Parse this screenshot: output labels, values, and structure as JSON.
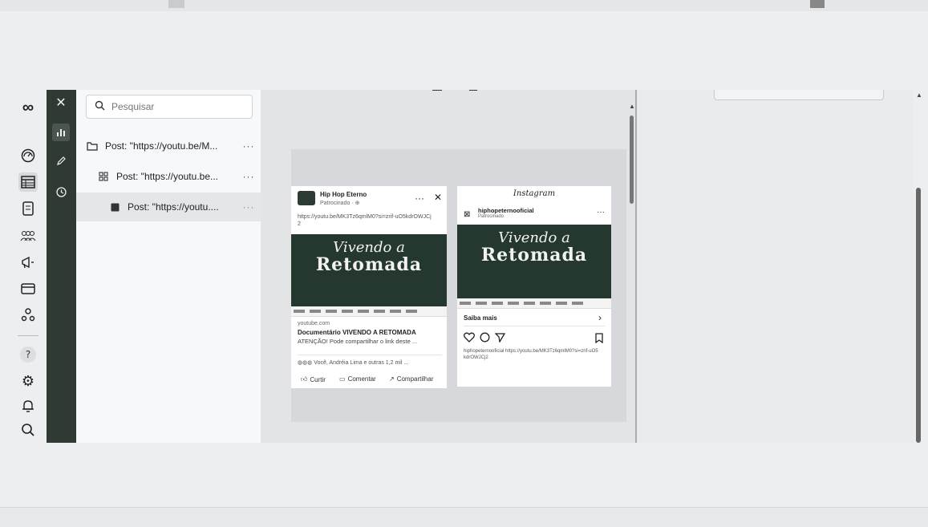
{
  "search": {
    "placeholder": "Pesquisar"
  },
  "tree": {
    "items": [
      {
        "label": "Post: \"https://youtu.be/M...",
        "more": "···"
      },
      {
        "label": "Post: \"https://youtu.be...",
        "more": "···"
      },
      {
        "label": "Post: \"https://youtu....",
        "more": "···"
      }
    ]
  },
  "facebook_post": {
    "page_name": "Hip Hop Eterno",
    "sponsored": "Patrocinado · ⊕",
    "link_text": "https://youtu.be/MK3Tz6qmlM0?si=zrif-uO5kdrOWJCj2",
    "banner_line1": "Vivendo a",
    "banner_line2": "Retomada",
    "domain": "youtube.com",
    "headline": "Documentário VIVENDO A RETOMADA",
    "description": "ATENÇÃO! Pode compartilhar o link deste ...",
    "reactions": "Você, Andréia Lima e outras 1,2 mil ...",
    "like": "Curtir",
    "comment": "Comentar",
    "share": "Compartilhar",
    "more": "···",
    "close": "✕"
  },
  "instagram_post": {
    "brand": "Instagram",
    "account": "hiphopeternooficial",
    "sponsored": "Patrocinado",
    "banner_line1": "Vivendo a",
    "banner_line2": "Retomada",
    "cta": "Saiba mais",
    "caption": "hiphopeternooficial https://youtu.be/MK3Tz6qmlM0?si=zrif-uO5kdrOWJCj2",
    "more": "···"
  },
  "colors": {
    "rail_dark": "#2f3a33",
    "banner": "#25382f",
    "accent": "#1c1e21"
  },
  "icons": {
    "rail": [
      "meta-logo-icon",
      "gauge-icon",
      "table-icon",
      "document-icon",
      "people-icon",
      "megaphone-icon",
      "billing-card-icon",
      "audience-icon",
      "help-icon",
      "settings-icon",
      "bell-icon",
      "search-icon"
    ],
    "strip": [
      "close-icon",
      "chart-icon",
      "pencil-icon",
      "history-icon"
    ]
  }
}
